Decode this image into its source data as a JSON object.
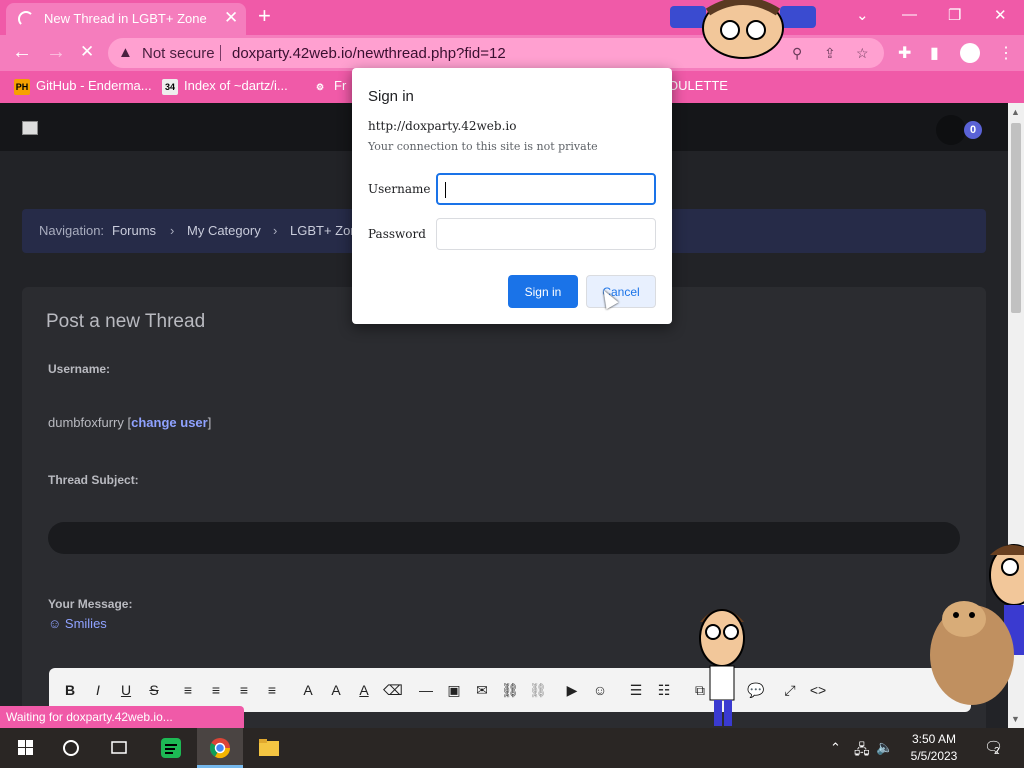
{
  "browser": {
    "tab_title": "New Thread in LGBT+ Zone",
    "tab_close": "✕",
    "new_tab": "+",
    "back": "←",
    "forward": "→",
    "reload": "✕",
    "security_label": "Not secure",
    "url": "doxparty.42web.io/newthread.php?fid=12",
    "status_text": "Waiting for doxparty.42web.io...",
    "window_controls": {
      "chevron": "⌄",
      "minimize": "—",
      "restore": "❐",
      "close": "✕"
    }
  },
  "bookmarks": [
    {
      "label": "GitHub - Enderma...",
      "icon": "PH",
      "icon_color": "#f7a000"
    },
    {
      "label": "Index of ~dartz/i...",
      "icon": "34",
      "icon_color": "#eeeeee"
    },
    {
      "label": "Fr",
      "icon": "⚙",
      "icon_color": "#f05aa8"
    },
    {
      "label": "OULETTE",
      "icon": "",
      "icon_color": "#f05aa8"
    }
  ],
  "page": {
    "notification_count": "0",
    "breadcrumb": {
      "prefix": "Navigation:",
      "items": [
        "Forums",
        "My Category",
        "LGBT+ Zon"
      ],
      "separator": "›"
    },
    "heading": "Post a new Thread",
    "username_label": "Username:",
    "username_value": "dumbfoxfurry",
    "change_user_open": "[",
    "change_user_link": "change user",
    "change_user_close": "]",
    "subject_label": "Thread Subject:",
    "message_label": "Your Message:",
    "smilies_icon": "☺",
    "smilies_label": "Smilies"
  },
  "editor_toolbar": [
    "B",
    "I",
    "U",
    "S",
    "≡",
    "≡",
    "≡",
    "≡",
    "A",
    "A",
    "A",
    "⌫",
    "—",
    "▣",
    "✉",
    "⛓",
    "⛓",
    "▶",
    "☺",
    "☰",
    "☷",
    "⧉",
    "💬",
    "⤢",
    "<>"
  ],
  "dialog": {
    "title": "Sign in",
    "host": "http://doxparty.42web.io",
    "warning": "Your connection to this site is not private",
    "username_label": "Username",
    "password_label": "Password",
    "username_value": "",
    "password_value": "",
    "signin_button": "Sign in",
    "cancel_button": "Cancel"
  },
  "taskbar": {
    "time": "3:50 AM",
    "date": "5/5/2023",
    "notification_count": "2"
  },
  "colors": {
    "browser_theme": "#f05aa8",
    "accent_blue": "#1a73e8",
    "link": "#8fa2ff",
    "page_bg": "#222327",
    "nav_bg": "#262b48"
  }
}
